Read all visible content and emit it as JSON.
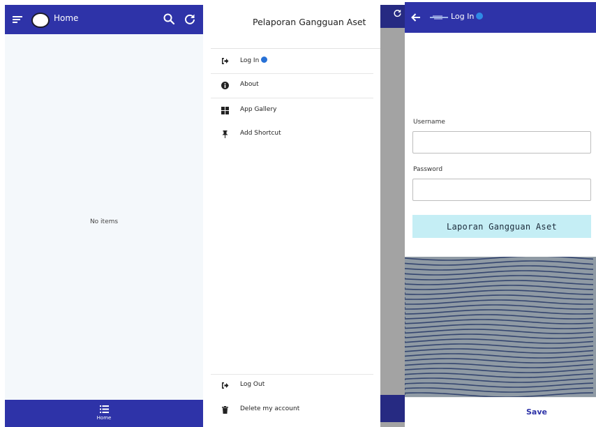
{
  "colors": {
    "primary": "#2e33a8",
    "primary_dimmed": "#262a82",
    "dot": "#2871d6",
    "banner_bg": "#c5eef5",
    "wave_bg": "#8f9aa4",
    "wave_line": "#34456f"
  },
  "home": {
    "title": "Home",
    "empty_text": "No items",
    "bottom_nav_label": "Home",
    "icons": [
      "menu-icon",
      "avatar",
      "search-icon",
      "refresh-icon",
      "list-icon"
    ]
  },
  "drawer": {
    "header_title": "Pelaporan Gangguan Aset",
    "items": [
      {
        "label": "Log In",
        "icon": "login-icon"
      },
      {
        "label": "About",
        "icon": "info-icon"
      },
      {
        "label": "App Gallery",
        "icon": "gallery-icon"
      },
      {
        "label": "Add Shortcut",
        "icon": "pin-icon"
      }
    ],
    "bottom_items": [
      {
        "label": "Log Out",
        "icon": "logout-icon"
      },
      {
        "label": "Delete my account",
        "icon": "trash-icon"
      }
    ]
  },
  "login": {
    "title": "Log In",
    "username_label": "Username",
    "username_value": "",
    "password_label": "Password",
    "password_value": "",
    "banner_text": "Laporan Gangguan Aset",
    "save_label": "Save"
  }
}
